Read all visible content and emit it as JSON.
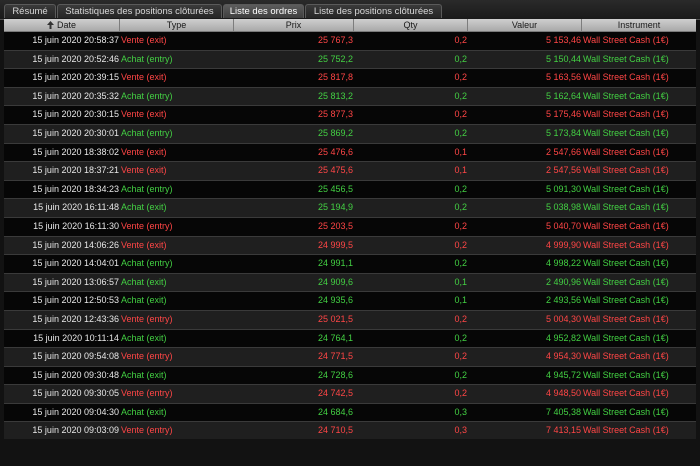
{
  "tabs": [
    {
      "label": "Résumé",
      "active": false
    },
    {
      "label": "Statistiques des positions clôturées",
      "active": false
    },
    {
      "label": "Liste des ordres",
      "active": true
    },
    {
      "label": "Liste des positions clôturées",
      "active": false
    }
  ],
  "columns": {
    "date": "Date",
    "type": "Type",
    "prix": "Prix",
    "qty": "Qty",
    "valeur": "Valeur",
    "instrument": "Instrument"
  },
  "sort": {
    "column": "date",
    "icon": "sort-ascending-icon"
  },
  "colors": {
    "buy": "#43d043",
    "sell": "#ff4646",
    "header": "#bcbcbc"
  },
  "rows": [
    {
      "date": "15 juin 2020 20:58:37",
      "type": "Vente (exit)",
      "prix": "25 767,3",
      "qty": "0,2",
      "valeur": "5 153,46",
      "instrument": "Wall Street Cash (1€)",
      "side": "sell"
    },
    {
      "date": "15 juin 2020 20:52:46",
      "type": "Achat (entry)",
      "prix": "25 752,2",
      "qty": "0,2",
      "valeur": "5 150,44",
      "instrument": "Wall Street Cash (1€)",
      "side": "buy"
    },
    {
      "date": "15 juin 2020 20:39:15",
      "type": "Vente (exit)",
      "prix": "25 817,8",
      "qty": "0,2",
      "valeur": "5 163,56",
      "instrument": "Wall Street Cash (1€)",
      "side": "sell"
    },
    {
      "date": "15 juin 2020 20:35:32",
      "type": "Achat (entry)",
      "prix": "25 813,2",
      "qty": "0,2",
      "valeur": "5 162,64",
      "instrument": "Wall Street Cash (1€)",
      "side": "buy"
    },
    {
      "date": "15 juin 2020 20:30:15",
      "type": "Vente (exit)",
      "prix": "25 877,3",
      "qty": "0,2",
      "valeur": "5 175,46",
      "instrument": "Wall Street Cash (1€)",
      "side": "sell"
    },
    {
      "date": "15 juin 2020 20:30:01",
      "type": "Achat (entry)",
      "prix": "25 869,2",
      "qty": "0,2",
      "valeur": "5 173,84",
      "instrument": "Wall Street Cash (1€)",
      "side": "buy"
    },
    {
      "date": "15 juin 2020 18:38:02",
      "type": "Vente (exit)",
      "prix": "25 476,6",
      "qty": "0,1",
      "valeur": "2 547,66",
      "instrument": "Wall Street Cash (1€)",
      "side": "sell"
    },
    {
      "date": "15 juin 2020 18:37:21",
      "type": "Vente (exit)",
      "prix": "25 475,6",
      "qty": "0,1",
      "valeur": "2 547,56",
      "instrument": "Wall Street Cash (1€)",
      "side": "sell"
    },
    {
      "date": "15 juin 2020 18:34:23",
      "type": "Achat (entry)",
      "prix": "25 456,5",
      "qty": "0,2",
      "valeur": "5 091,30",
      "instrument": "Wall Street Cash (1€)",
      "side": "buy"
    },
    {
      "date": "15 juin 2020 16:11:48",
      "type": "Achat (exit)",
      "prix": "25 194,9",
      "qty": "0,2",
      "valeur": "5 038,98",
      "instrument": "Wall Street Cash (1€)",
      "side": "buy"
    },
    {
      "date": "15 juin 2020 16:11:30",
      "type": "Vente (entry)",
      "prix": "25 203,5",
      "qty": "0,2",
      "valeur": "5 040,70",
      "instrument": "Wall Street Cash (1€)",
      "side": "sell"
    },
    {
      "date": "15 juin 2020 14:06:26",
      "type": "Vente (exit)",
      "prix": "24 999,5",
      "qty": "0,2",
      "valeur": "4 999,90",
      "instrument": "Wall Street Cash (1€)",
      "side": "sell"
    },
    {
      "date": "15 juin 2020 14:04:01",
      "type": "Achat (entry)",
      "prix": "24 991,1",
      "qty": "0,2",
      "valeur": "4 998,22",
      "instrument": "Wall Street Cash (1€)",
      "side": "buy"
    },
    {
      "date": "15 juin 2020 13:06:57",
      "type": "Achat (exit)",
      "prix": "24 909,6",
      "qty": "0,1",
      "valeur": "2 490,96",
      "instrument": "Wall Street Cash (1€)",
      "side": "buy"
    },
    {
      "date": "15 juin 2020 12:50:53",
      "type": "Achat (exit)",
      "prix": "24 935,6",
      "qty": "0,1",
      "valeur": "2 493,56",
      "instrument": "Wall Street Cash (1€)",
      "side": "buy"
    },
    {
      "date": "15 juin 2020 12:43:36",
      "type": "Vente (entry)",
      "prix": "25 021,5",
      "qty": "0,2",
      "valeur": "5 004,30",
      "instrument": "Wall Street Cash (1€)",
      "side": "sell"
    },
    {
      "date": "15 juin 2020 10:11:14",
      "type": "Achat (exit)",
      "prix": "24 764,1",
      "qty": "0,2",
      "valeur": "4 952,82",
      "instrument": "Wall Street Cash (1€)",
      "side": "buy"
    },
    {
      "date": "15 juin 2020 09:54:08",
      "type": "Vente (entry)",
      "prix": "24 771,5",
      "qty": "0,2",
      "valeur": "4 954,30",
      "instrument": "Wall Street Cash (1€)",
      "side": "sell"
    },
    {
      "date": "15 juin 2020 09:30:48",
      "type": "Achat (exit)",
      "prix": "24 728,6",
      "qty": "0,2",
      "valeur": "4 945,72",
      "instrument": "Wall Street Cash (1€)",
      "side": "buy"
    },
    {
      "date": "15 juin 2020 09:30:05",
      "type": "Vente (entry)",
      "prix": "24 742,5",
      "qty": "0,2",
      "valeur": "4 948,50",
      "instrument": "Wall Street Cash (1€)",
      "side": "sell"
    },
    {
      "date": "15 juin 2020 09:04:30",
      "type": "Achat (exit)",
      "prix": "24 684,6",
      "qty": "0,3",
      "valeur": "7 405,38",
      "instrument": "Wall Street Cash (1€)",
      "side": "buy"
    },
    {
      "date": "15 juin 2020 09:03:09",
      "type": "Vente (entry)",
      "prix": "24 710,5",
      "qty": "0,3",
      "valeur": "7 413,15",
      "instrument": "Wall Street Cash (1€)",
      "side": "sell"
    }
  ]
}
